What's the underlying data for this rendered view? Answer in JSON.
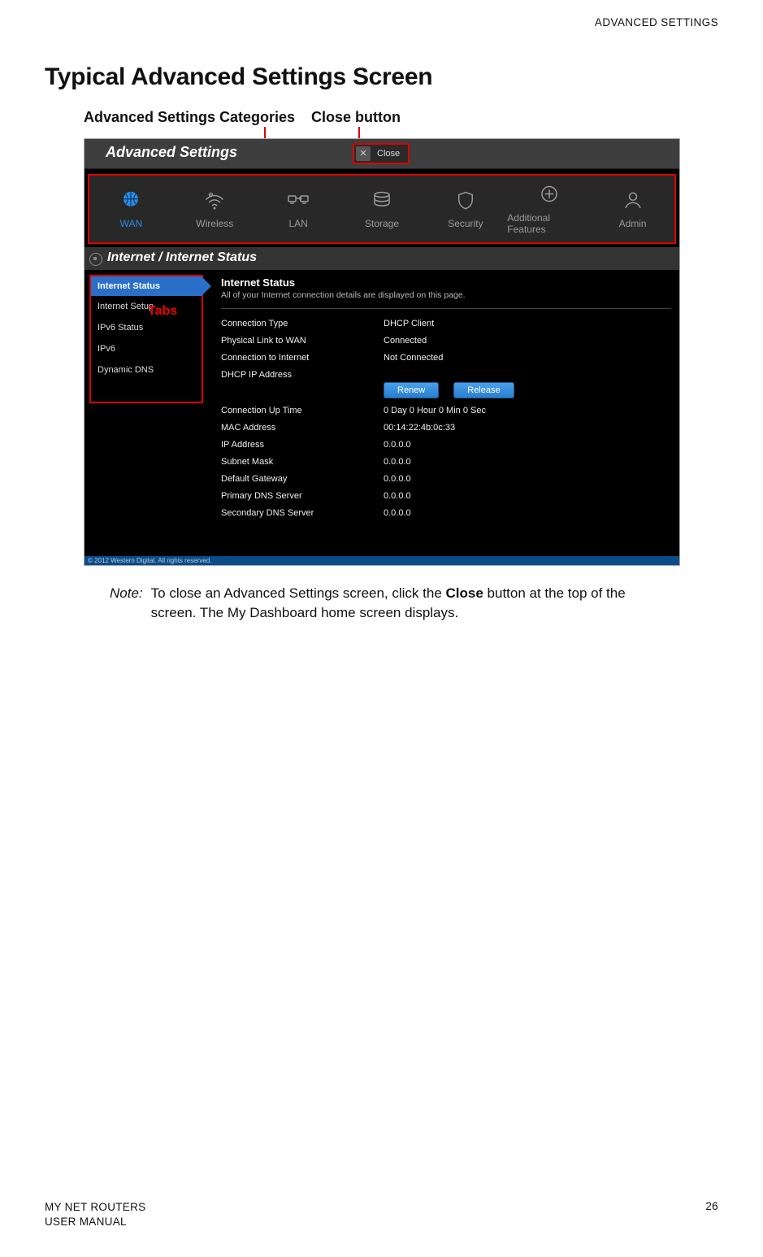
{
  "header": {
    "section": "ADVANCED SETTINGS"
  },
  "page_title": "Typical Advanced Settings Screen",
  "callouts": {
    "categories": "Advanced Settings Categories",
    "close": "Close button",
    "tabs": "Tabs"
  },
  "screenshot": {
    "title": "Advanced Settings",
    "close_label": "Close",
    "categories": [
      {
        "id": "wan",
        "label": "WAN",
        "active": true
      },
      {
        "id": "wireless",
        "label": "Wireless"
      },
      {
        "id": "lan",
        "label": "LAN"
      },
      {
        "id": "storage",
        "label": "Storage"
      },
      {
        "id": "security",
        "label": "Security"
      },
      {
        "id": "addl",
        "label": "Additional Features"
      },
      {
        "id": "admin",
        "label": "Admin"
      }
    ],
    "crumb": "Internet / Internet Status",
    "tabs": [
      {
        "label": "Internet Status",
        "active": true
      },
      {
        "label": "Internet Setup"
      },
      {
        "label": "IPv6 Status"
      },
      {
        "label": "IPv6"
      },
      {
        "label": "Dynamic DNS"
      }
    ],
    "section": {
      "title": "Internet Status",
      "subtitle": "All of your Internet connection details are displayed on this page.",
      "rows": [
        {
          "k": "Connection Type",
          "v": "DHCP Client"
        },
        {
          "k": "Physical Link to WAN",
          "v": "Connected"
        },
        {
          "k": "Connection to Internet",
          "v": "Not Connected"
        },
        {
          "k": "DHCP IP Address",
          "buttons": [
            "Renew",
            "Release"
          ]
        },
        {
          "k": "Connection Up Time",
          "v": "0 Day 0 Hour 0 Min 0 Sec"
        },
        {
          "k": "MAC Address",
          "v": "00:14:22:4b:0c:33"
        },
        {
          "k": "IP Address",
          "v": "0.0.0.0"
        },
        {
          "k": "Subnet Mask",
          "v": "0.0.0.0"
        },
        {
          "k": "Default Gateway",
          "v": "0.0.0.0"
        },
        {
          "k": "Primary DNS Server",
          "v": "0.0.0.0"
        },
        {
          "k": "Secondary DNS Server",
          "v": "0.0.0.0"
        }
      ]
    },
    "copyright": "© 2012 Western Digital. All rights reserved."
  },
  "note": {
    "label": "Note:",
    "part1": "To close an Advanced Settings screen, click the ",
    "bold": "Close",
    "part2": " button at the top of the screen. The My Dashboard home screen displays."
  },
  "footer": {
    "line1": "MY NET ROUTERS",
    "line2": "USER MANUAL",
    "page_number": "26"
  }
}
